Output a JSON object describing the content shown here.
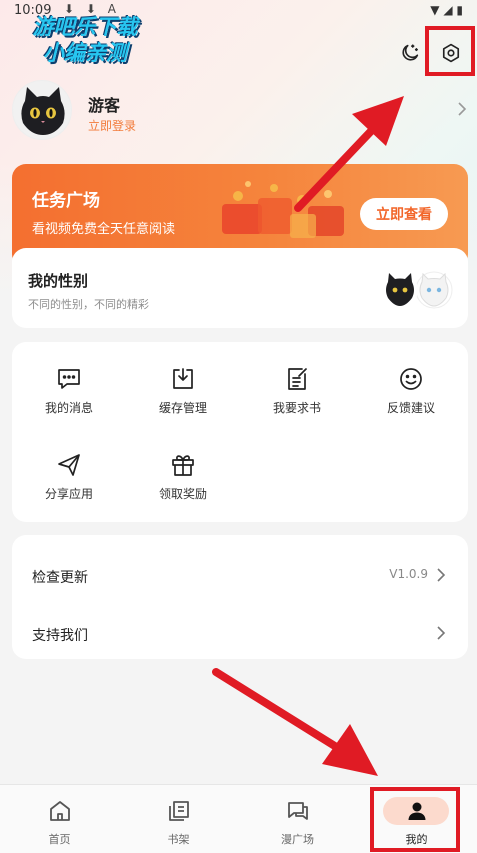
{
  "status_bar": {
    "time": "10:09",
    "download_icons": "⬇ ⬇ A",
    "right_icons": "▼ ◢ ▮"
  },
  "watermark": {
    "line1": "游吧乐下载",
    "line2": "小编亲测"
  },
  "header": {
    "night_mode_icon": "moon-icon",
    "settings_icon": "gear-icon"
  },
  "profile": {
    "name": "游客",
    "login_label": "立即登录"
  },
  "task_card": {
    "title": "任务广场",
    "subtitle": "看视频免费全天任意阅读",
    "button": "立即查看"
  },
  "gender_card": {
    "title": "我的性别",
    "subtitle": "不同的性别，不同的精彩"
  },
  "grid": [
    {
      "label": "我的消息",
      "icon": "message-icon"
    },
    {
      "label": "缓存管理",
      "icon": "download-icon"
    },
    {
      "label": "我要求书",
      "icon": "edit-note-icon"
    },
    {
      "label": "反馈建议",
      "icon": "smile-icon"
    },
    {
      "label": "分享应用",
      "icon": "send-icon"
    },
    {
      "label": "领取奖励",
      "icon": "gift-icon"
    }
  ],
  "list": [
    {
      "label": "检查更新",
      "value": "V1.0.9"
    },
    {
      "label": "支持我们",
      "value": ""
    }
  ],
  "tabs": [
    {
      "label": "首页",
      "icon": "home-icon",
      "active": false
    },
    {
      "label": "书架",
      "icon": "bookshelf-icon",
      "active": false
    },
    {
      "label": "漫广场",
      "icon": "chat-icon",
      "active": false
    },
    {
      "label": "我的",
      "icon": "user-icon",
      "active": true
    }
  ],
  "colors": {
    "accent": "#f46f30",
    "login_text": "#f27b3a",
    "annotation_red": "#e01b24",
    "active_tab_pill": "#fcdacd"
  }
}
